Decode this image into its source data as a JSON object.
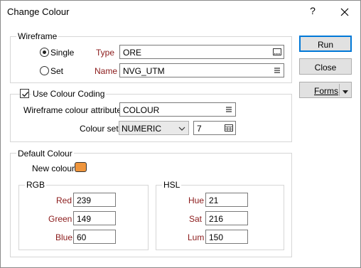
{
  "dialog": {
    "title": "Change Colour",
    "help_glyph": "?"
  },
  "wireframe": {
    "legend": "Wireframe",
    "single_label": "Single",
    "set_label": "Set",
    "single_selected": true,
    "type_label": "Type",
    "type_value": "ORE",
    "name_label": "Name",
    "name_value": "NVG_UTM"
  },
  "colour_coding": {
    "checkbox_label": "Use Colour Coding",
    "checked": true,
    "attribute_label": "Wireframe colour attribute",
    "attribute_value": "COLOUR",
    "colour_set_label": "Colour set",
    "colour_set_value": "NUMERIC",
    "colour_set_number": "7"
  },
  "default_colour": {
    "legend": "Default Colour",
    "new_colour_label": "New colour",
    "swatch_color": "#EF953C",
    "rgb": {
      "legend": "RGB",
      "red_label": "Red",
      "red": "239",
      "green_label": "Green",
      "green": "149",
      "blue_label": "Blue",
      "blue": "60"
    },
    "hsl": {
      "legend": "HSL",
      "hue_label": "Hue",
      "hue": "21",
      "sat_label": "Sat",
      "sat": "216",
      "lum_label": "Lum",
      "lum": "150"
    }
  },
  "buttons": {
    "run": "Run",
    "close": "Close",
    "forms": "Forms"
  },
  "icons": {
    "close": "close-icon",
    "browse": "browse-icon",
    "list": "list-icon",
    "calendar": "grid-picker-icon",
    "chevron": "chevron-down-icon",
    "dropdown": "triangle-down-icon"
  }
}
